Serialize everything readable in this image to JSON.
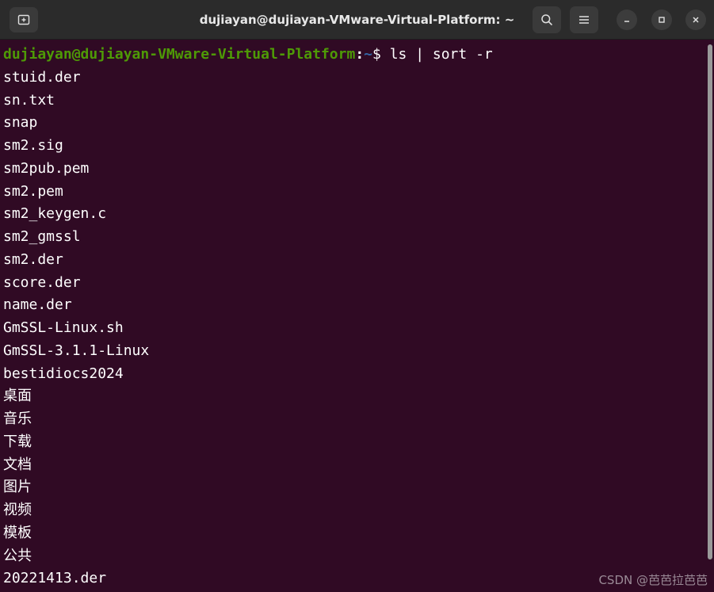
{
  "window": {
    "title": "dujiayan@dujiayan-VMware-Virtual-Platform: ~"
  },
  "header": {
    "icons": {
      "new_tab": "new-tab-icon",
      "search": "search-icon",
      "menu": "hamburger-menu-icon",
      "minimize": "minimize-icon",
      "maximize": "maximize-icon",
      "close": "close-icon"
    }
  },
  "terminal": {
    "prompt": {
      "user_host": "dujiayan@dujiayan-VMware-Virtual-Platform",
      "separator": ":",
      "path": "~",
      "symbol": "$ ",
      "command": "ls | sort -r"
    },
    "output": [
      "stuid.der",
      "sn.txt",
      "snap",
      "sm2.sig",
      "sm2pub.pem",
      "sm2.pem",
      "sm2_keygen.c",
      "sm2_gmssl",
      "sm2.der",
      "score.der",
      "name.der",
      "GmSSL-Linux.sh",
      "GmSSL-3.1.1-Linux",
      "bestidiocs2024",
      "桌面",
      "音乐",
      "下载",
      "文档",
      "图片",
      "视频",
      "模板",
      "公共",
      "20221413.der"
    ]
  },
  "watermark": "CSDN @芭芭拉芭芭",
  "colors": {
    "terminal_bg": "#300a24",
    "titlebar_bg": "#2b2b2b",
    "prompt_user": "#4e9a06",
    "prompt_path": "#3465a4",
    "text": "#ffffff"
  }
}
